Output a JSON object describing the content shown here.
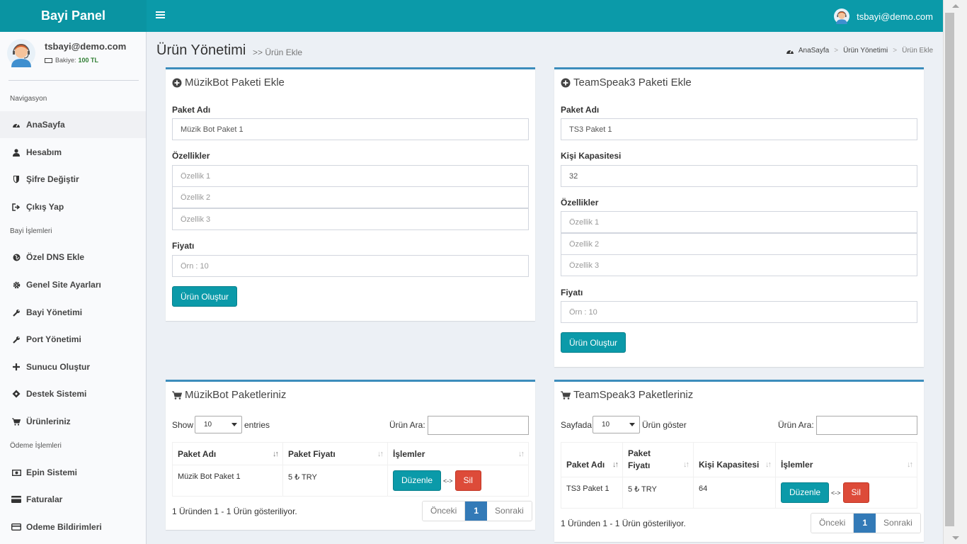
{
  "header": {
    "logo": "Bayi Panel",
    "user_email": "tsbayi@demo.com"
  },
  "sidebar": {
    "user_email": "tsbayi@demo.com",
    "balance_label": "Bakiye:",
    "balance_value": "100 TL",
    "sections": [
      {
        "title": "Navigasyon"
      },
      {
        "title": "Bayi İşlemleri"
      },
      {
        "title": "Ödeme İşlemleri"
      }
    ],
    "items": [
      {
        "label": "AnaSayfa",
        "icon": "dashboard-icon"
      },
      {
        "label": "Hesabım",
        "icon": "user-icon"
      },
      {
        "label": "Şifre Değiştir",
        "icon": "shield-icon"
      },
      {
        "label": "Çıkış Yap",
        "icon": "sign-out-icon"
      },
      {
        "label": "Özel DNS Ekle",
        "icon": "globe-icon"
      },
      {
        "label": "Genel Site Ayarları",
        "icon": "gear-icon"
      },
      {
        "label": "Bayi Yönetimi",
        "icon": "wrench-icon"
      },
      {
        "label": "Port Yönetimi",
        "icon": "wrench-icon"
      },
      {
        "label": "Sunucu Oluştur",
        "icon": "plus-icon"
      },
      {
        "label": "Destek Sistemi",
        "icon": "ticket-icon"
      },
      {
        "label": "Ürünleriniz",
        "icon": "cart-icon"
      },
      {
        "label": "Epin Sistemi",
        "icon": "money-icon"
      },
      {
        "label": "Faturalar",
        "icon": "credit-card-icon"
      },
      {
        "label": "Odeme Bildirimleri",
        "icon": "credit-card-icon"
      }
    ]
  },
  "page": {
    "title": "Ürün Yönetimi",
    "subtitle": ">> Ürün Ekle",
    "breadcrumb": [
      "AnaSayfa",
      "Ürün Yönetimi",
      "Ürün Ekle"
    ],
    "breadcrumb_sep": ">"
  },
  "musicbot_form": {
    "title": "MüzikBot Paketi Ekle",
    "name_label": "Paket Adı",
    "name_value": "Müzik Bot Paket 1",
    "features_label": "Özellikler",
    "feature_placeholders": [
      "Özellik 1",
      "Özellik 2",
      "Özellik 3"
    ],
    "price_label": "Fiyatı",
    "price_placeholder": "Örn : 10",
    "submit_label": "Ürün Oluştur"
  },
  "ts3_form": {
    "title": "TeamSpeak3 Paketi Ekle",
    "name_label": "Paket Adı",
    "name_value": "TS3 Paket 1",
    "capacity_label": "Kişi Kapasitesi",
    "capacity_value": "32",
    "features_label": "Özellikler",
    "feature_placeholders": [
      "Özellik 1",
      "Özellik 2",
      "Özellik 3"
    ],
    "price_label": "Fiyatı",
    "price_placeholder": "Örn : 10",
    "submit_label": "Ürün Oluştur"
  },
  "musicbot_table": {
    "title": "MüzikBot Paketleriniz",
    "show_label": "Show",
    "entries_value": "10",
    "entries_label": "entries",
    "search_label": "Ürün Ara:",
    "columns": [
      "Paket Adı",
      "Paket Fiyatı",
      "İşlemler"
    ],
    "rows": [
      {
        "name": "Müzik Bot Paket 1",
        "price": "5 ₺ TRY"
      }
    ],
    "edit_label": "Düzenle",
    "arrow_text": "<->",
    "delete_label": "Sil",
    "info": "1 Üründen 1 - 1 Ürün gösteriliyor.",
    "prev_label": "Önceki",
    "page": "1",
    "next_label": "Sonraki"
  },
  "ts3_table": {
    "title": "TeamSpeak3 Paketleriniz",
    "show_label": "Sayfada",
    "entries_value": "10",
    "entries_label": "Ürün göster",
    "search_label": "Ürün Ara:",
    "columns": [
      "Paket Adı",
      "Paket Fiyatı",
      "Kişi Kapasitesi",
      "İşlemler"
    ],
    "rows": [
      {
        "name": "TS3 Paket 1",
        "price": "5 ₺ TRY",
        "capacity": "64"
      }
    ],
    "edit_label": "Düzenle",
    "arrow_text": "<->",
    "delete_label": "Sil",
    "info": "1 Üründen 1 - 1 Ürün gösteriliyor.",
    "prev_label": "Önceki",
    "page": "1",
    "next_label": "Sonraki"
  }
}
